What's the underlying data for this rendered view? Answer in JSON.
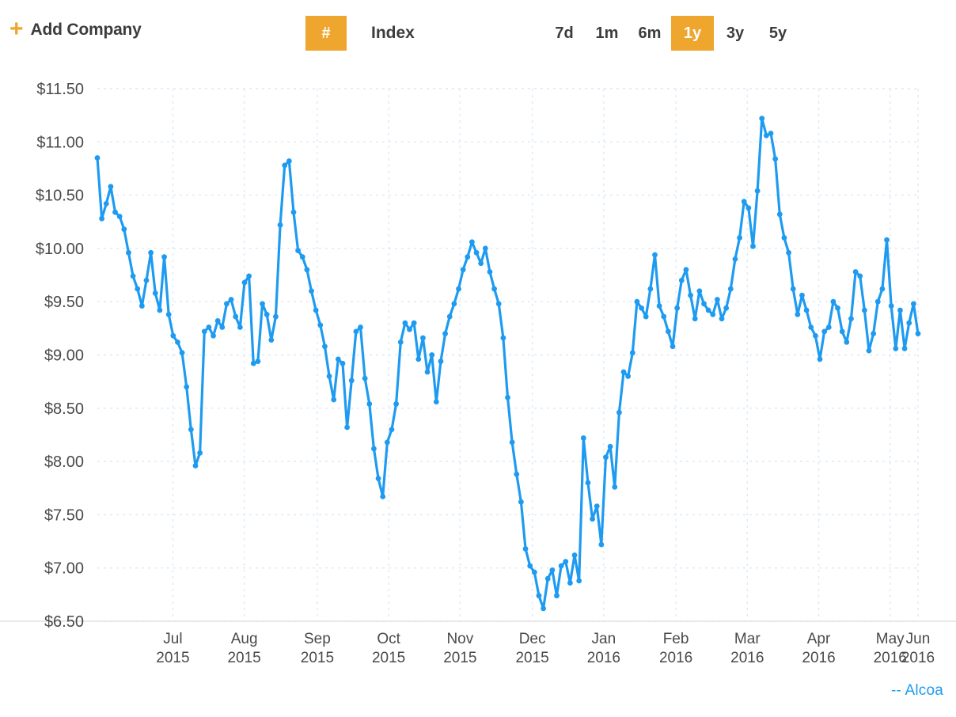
{
  "toolbar": {
    "add_company": {
      "icon": "plus-icon",
      "label": "Add Company"
    },
    "index": {
      "badge": "#",
      "label": "Index"
    },
    "ranges": [
      {
        "label": "7d",
        "active": false
      },
      {
        "label": "1m",
        "active": false
      },
      {
        "label": "6m",
        "active": false
      },
      {
        "label": "1y",
        "active": true
      },
      {
        "label": "3y",
        "active": false
      },
      {
        "label": "5y",
        "active": false
      }
    ]
  },
  "legend": {
    "text": "-- Alcoa"
  },
  "colors": {
    "accent_orange": "#efa62e",
    "series_blue": "#1e9bf0",
    "grid": "#dce9f7",
    "text": "#3c3c3c"
  },
  "chart_data": {
    "type": "line",
    "title": "",
    "xlabel": "",
    "ylabel": "",
    "grid": true,
    "legend_position": "bottom-right",
    "ylim": [
      6.5,
      11.5
    ],
    "ytick_labels": [
      "$11.50",
      "$11.00",
      "$10.50",
      "$10.00",
      "$9.50",
      "$9.00",
      "$8.50",
      "$8.00",
      "$7.50",
      "$7.00",
      "$6.50"
    ],
    "yticks": [
      11.5,
      11.0,
      10.5,
      10.0,
      9.5,
      9.0,
      8.5,
      8.0,
      7.5,
      7.0,
      6.5
    ],
    "xtick_labels": [
      [
        "Jul",
        "2015"
      ],
      [
        "Aug",
        "2015"
      ],
      [
        "Sep",
        "2015"
      ],
      [
        "Oct",
        "2015"
      ],
      [
        "Nov",
        "2015"
      ],
      [
        "Dec",
        "2015"
      ],
      [
        "Jan",
        "2016"
      ],
      [
        "Feb",
        "2016"
      ],
      [
        "Mar",
        "2016"
      ],
      [
        "Apr",
        "2016"
      ],
      [
        "May",
        "2016"
      ],
      [
        "Jun",
        "2016"
      ]
    ],
    "xtick_positions": [
      0.092,
      0.179,
      0.268,
      0.355,
      0.442,
      0.53,
      0.617,
      0.705,
      0.792,
      0.879,
      0.966,
      1.0
    ],
    "series": [
      {
        "name": "Alcoa",
        "color": "#1e9bf0",
        "markers": true,
        "values": [
          10.85,
          10.28,
          10.42,
          10.58,
          10.34,
          10.3,
          10.18,
          9.96,
          9.74,
          9.62,
          9.46,
          9.7,
          9.96,
          9.58,
          9.42,
          9.92,
          9.38,
          9.18,
          9.12,
          9.02,
          8.7,
          8.3,
          7.96,
          8.08,
          9.22,
          9.26,
          9.18,
          9.32,
          9.26,
          9.48,
          9.52,
          9.36,
          9.26,
          9.68,
          9.74,
          8.92,
          8.94,
          9.48,
          9.38,
          9.14,
          9.36,
          10.22,
          10.78,
          10.82,
          10.34,
          9.98,
          9.92,
          9.8,
          9.6,
          9.42,
          9.28,
          9.08,
          8.8,
          8.58,
          8.96,
          8.92,
          8.32,
          8.76,
          9.22,
          9.26,
          8.78,
          8.54,
          8.12,
          7.84,
          7.67,
          8.18,
          8.3,
          8.54,
          9.12,
          9.3,
          9.24,
          9.3,
          8.96,
          9.16,
          8.84,
          9.0,
          8.56,
          8.94,
          9.2,
          9.36,
          9.48,
          9.62,
          9.8,
          9.92,
          10.06,
          9.96,
          9.86,
          10.0,
          9.78,
          9.62,
          9.48,
          9.16,
          8.6,
          8.18,
          7.88,
          7.62,
          7.18,
          7.02,
          6.96,
          6.74,
          6.62,
          6.9,
          6.98,
          6.74,
          7.02,
          7.06,
          6.86,
          7.12,
          6.88,
          8.22,
          7.8,
          7.46,
          7.58,
          7.22,
          8.04,
          8.14,
          7.76,
          8.46,
          8.84,
          8.8,
          9.02,
          9.5,
          9.44,
          9.36,
          9.62,
          9.94,
          9.46,
          9.36,
          9.22,
          9.08,
          9.44,
          9.7,
          9.8,
          9.56,
          9.34,
          9.6,
          9.48,
          9.42,
          9.38,
          9.52,
          9.34,
          9.44,
          9.62,
          9.9,
          10.1,
          10.44,
          10.38,
          10.02,
          10.54,
          11.22,
          11.06,
          11.08,
          10.84,
          10.32,
          10.1,
          9.96,
          9.62,
          9.38,
          9.56,
          9.42,
          9.26,
          9.18,
          8.96,
          9.22,
          9.26,
          9.5,
          9.44,
          9.22,
          9.12,
          9.34,
          9.78,
          9.74,
          9.42,
          9.04,
          9.2,
          9.5,
          9.62,
          10.08,
          9.46,
          9.06,
          9.42,
          9.06,
          9.3,
          9.48,
          9.2
        ]
      }
    ]
  }
}
